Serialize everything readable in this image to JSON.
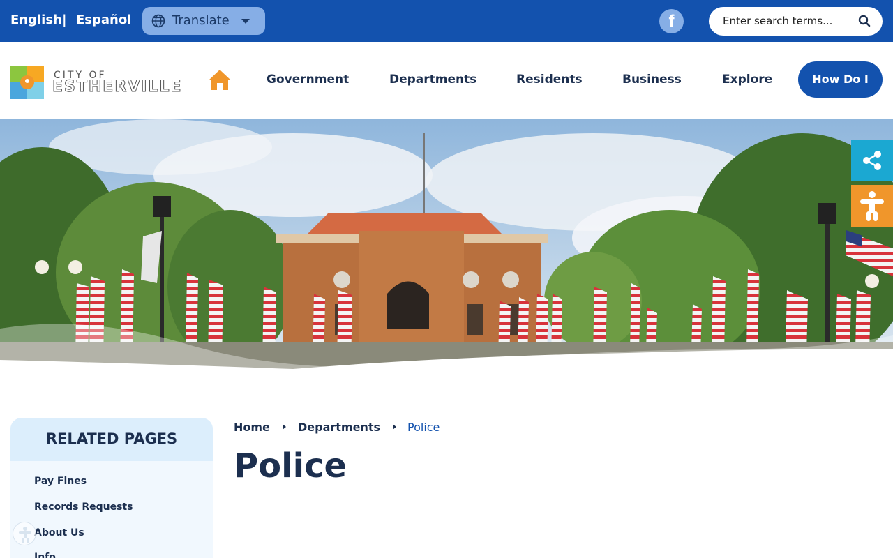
{
  "topbar": {
    "lang_english": "English",
    "lang_separator": "|",
    "lang_spanish": "Español",
    "translate_label": "Translate",
    "search_placeholder": "Enter search terms...",
    "facebook_glyph": "f"
  },
  "logo": {
    "city_of": "CITY OF",
    "city_name": "ESTHERVILLE"
  },
  "nav": {
    "items": [
      "Government",
      "Departments",
      "Residents",
      "Business",
      "Explore"
    ],
    "cta": "How Do I"
  },
  "related": {
    "title": "RELATED PAGES",
    "items": [
      "Pay Fines",
      "Records Requests",
      "About Us",
      "Info"
    ]
  },
  "breadcrumb": {
    "items": [
      "Home",
      "Departments",
      "Police"
    ]
  },
  "page": {
    "title": "Police"
  },
  "colors": {
    "brand_blue": "#1352ae",
    "navy": "#1c2f4f",
    "share_teal": "#1ba8d2",
    "accessibility_orange": "#f0962b",
    "home_orange": "#f0962b"
  }
}
